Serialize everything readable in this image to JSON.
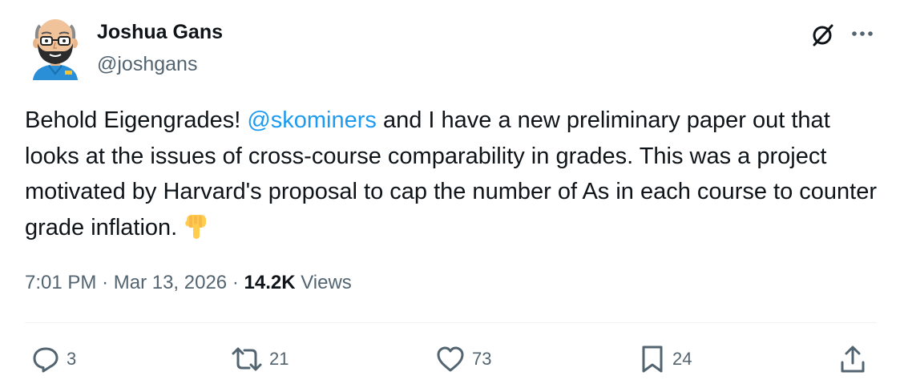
{
  "author": {
    "name": "Joshua Gans",
    "handle": "@joshgans",
    "avatar_icon": "cartoon-avatar-icon"
  },
  "header_icons": [
    "grok-icon",
    "more-options-icon"
  ],
  "tweet": {
    "text_before_mention": "Behold Eigengrades! ",
    "mention": "@skominers",
    "text_after_mention": " and I have a new preliminary paper out that looks at the issues of cross-course comparability in grades. This was a project motivated by Harvard's proposal to cap the number of As in each course to counter grade inflation.",
    "emoji_icon": "backhand-index-pointing-down-icon"
  },
  "meta": {
    "time": "7:01 PM",
    "separator": "·",
    "date": "Mar 13, 2026",
    "views_count": "14.2K",
    "views_label": "Views"
  },
  "actions": {
    "reply_count": "3",
    "retweet_count": "21",
    "like_count": "73",
    "bookmark_count": "24"
  },
  "colors": {
    "text": "#0f1419",
    "secondary": "#536471",
    "link": "#1d9bf0",
    "divider": "#eff3f4"
  }
}
